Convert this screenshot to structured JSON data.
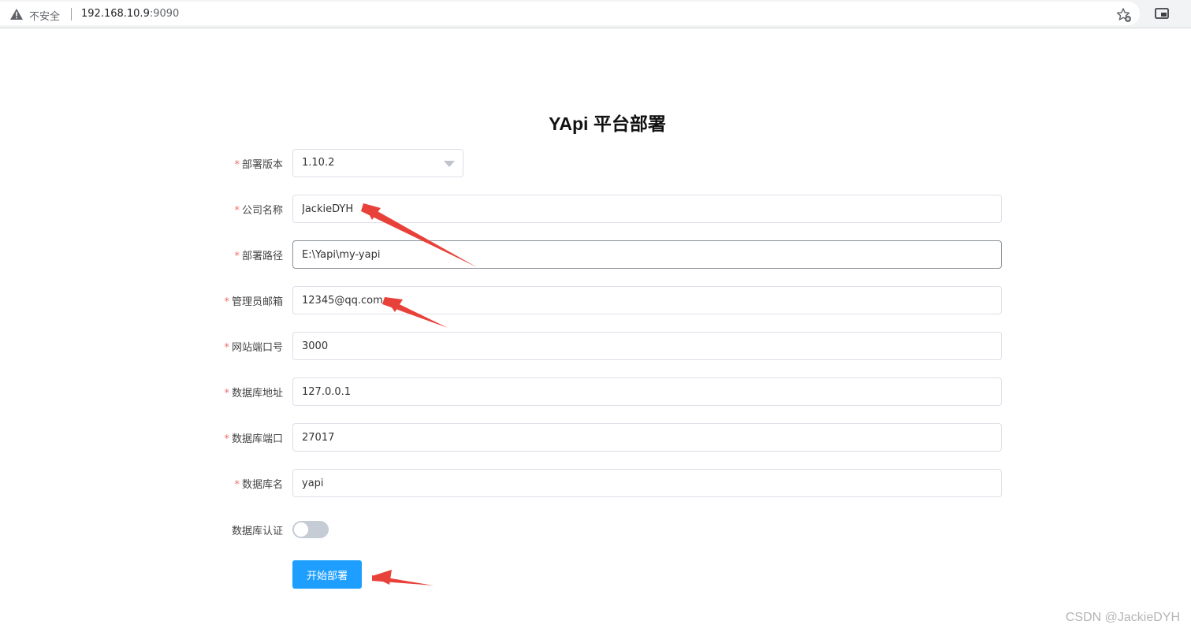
{
  "browser": {
    "security_label": "不安全",
    "url_host": "192.168.10.9",
    "url_port": ":9090"
  },
  "page": {
    "title": "YApi 平台部署"
  },
  "form": {
    "required_mark": "*",
    "version": {
      "label": "部署版本",
      "value": "1.10.2"
    },
    "company": {
      "label": "公司名称",
      "value": "JackieDYH"
    },
    "path": {
      "label": "部署路径",
      "value": "E:\\Yapi\\my-yapi"
    },
    "email": {
      "label": "管理员邮箱",
      "value": "12345@qq.com"
    },
    "port": {
      "label": "网站端口号",
      "value": "3000"
    },
    "db_host": {
      "label": "数据库地址",
      "value": "127.0.0.1"
    },
    "db_port": {
      "label": "数据库端口",
      "value": "27017"
    },
    "db_name": {
      "label": "数据库名",
      "value": "yapi"
    },
    "db_auth": {
      "label": "数据库认证",
      "enabled": false
    },
    "submit_label": "开始部署"
  },
  "watermark": "CSDN @JackieDYH",
  "colors": {
    "primary_button": "#1e9fff",
    "required": "#f56c6c",
    "annotation_arrow": "#e8413a",
    "switch_off": "#c6ccd6"
  },
  "icons": [
    "warning-icon",
    "bookmark-star-icon",
    "picture-in-picture-icon",
    "chevron-down-icon"
  ]
}
